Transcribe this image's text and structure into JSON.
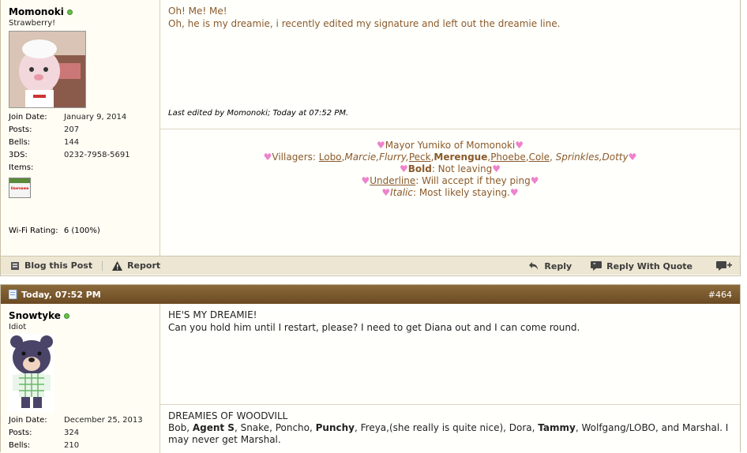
{
  "post1": {
    "username": "Momonoki",
    "user_title": "Strawberry!",
    "stats": [
      {
        "label": "Join Date:",
        "value": "January 9, 2014"
      },
      {
        "label": "Posts:",
        "value": "207"
      },
      {
        "label": "Bells:",
        "value": "144"
      },
      {
        "label": "3DS:",
        "value": "0232-7958-5691"
      },
      {
        "label": "Items:",
        "value": ""
      }
    ],
    "item_badge": "Username",
    "wifi_label": "Wi-Fi Rating:",
    "wifi_value": "6 (100%)",
    "message_line1": "Oh! Me! Me!",
    "message_line2": "Oh, he is my dreamie, i recently edited my signature and left out the dreamie line.",
    "edited": "Last edited by Momonoki; Today at 07:52 PM.",
    "sig": {
      "mayor": "Mayor Yumiko of Momonoki",
      "villagers_label": "Villagers:",
      "lobo": "Lobo",
      "italic_group1": "Marcie,Flurry,",
      "peck": "Peck",
      "merengue": "Merengue",
      "phoebe": "Phoebe",
      "cole": "Cole",
      "italic_group2": "Sprinkles,Dotty",
      "bold_label": "Bold",
      "bold_text": ": Not leaving",
      "underline_label": "Underline",
      "underline_text": ": Will accept if they ping",
      "italic_label": "Italic",
      "italic_text": ": Most likely staying."
    },
    "footer": {
      "blog": "Blog this Post",
      "report": "Report",
      "reply": "Reply",
      "reply_quote": "Reply With Quote"
    }
  },
  "post2": {
    "header_date": "Today, 07:52 PM",
    "post_number": "#464",
    "username": "Snowtyke",
    "user_title": "Idiot",
    "stats": [
      {
        "label": "Join Date:",
        "value": "December 25, 2013"
      },
      {
        "label": "Posts:",
        "value": "324"
      },
      {
        "label": "Bells:",
        "value": "210"
      }
    ],
    "message_line1": "HE'S MY DREAMIE!",
    "message_line2": "Can you hold him until I restart, please? I need to get Diana out and I can come round.",
    "sig_title": "DREAMIES OF WOODVILL",
    "sig_p1": "Bob, ",
    "sig_b1": "Agent S",
    "sig_p2": ", Snake, Poncho, ",
    "sig_b2": "Punchy",
    "sig_p3": ", Freya,(she really is quite nice), Dora, ",
    "sig_b3": "Tammy",
    "sig_p4": ", Wolfgang/LOBO, and Marshal. I may never get Marshal."
  }
}
